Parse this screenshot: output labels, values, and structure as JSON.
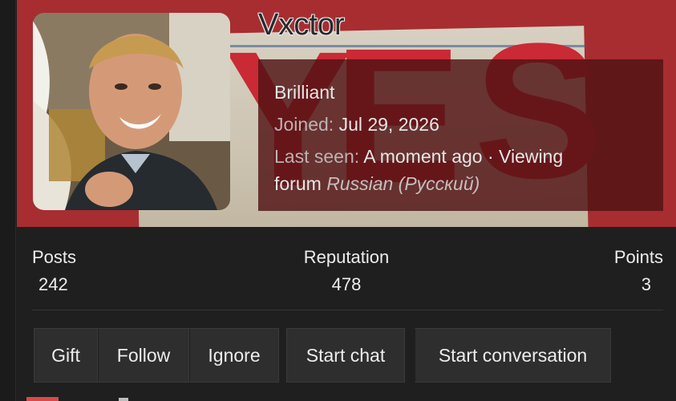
{
  "profile": {
    "username": "Vxctor",
    "title": "Brilliant",
    "joined_label": "Joined:",
    "joined_value": "Jul 29, 2026",
    "last_seen_label": "Last seen:",
    "last_seen_value": "A moment ago · Viewing",
    "last_seen_forum_prefix": "forum",
    "last_seen_forum_name": "Russian (Русский)"
  },
  "stats": {
    "posts_label": "Posts",
    "posts_value": "242",
    "reputation_label": "Reputation",
    "reputation_value": "478",
    "points_label": "Points",
    "points_value": "3"
  },
  "actions": {
    "gift": "Gift",
    "follow": "Follow",
    "ignore": "Ignore",
    "start_chat": "Start chat",
    "start_conversation": "Start conversation"
  },
  "colors": {
    "banner_red": "#a72d31",
    "info_overlay": "#501214",
    "page_bg": "#1f1f1f",
    "button_bg": "#2e2e2e"
  }
}
